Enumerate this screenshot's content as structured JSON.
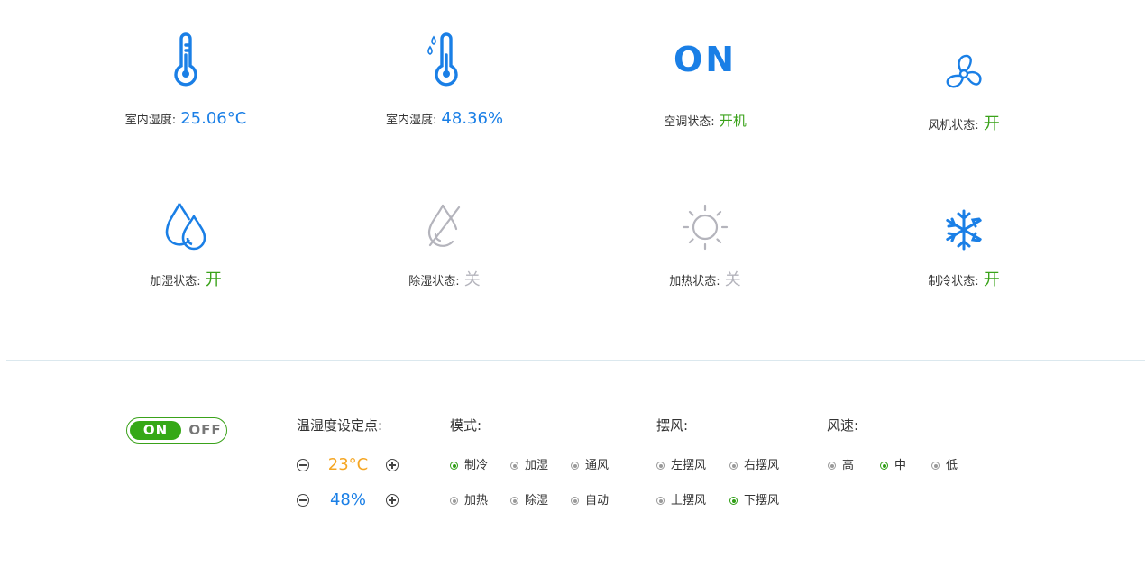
{
  "status": {
    "indoor_temp": {
      "label": "室内湿度:",
      "value": "25.06°C",
      "icon": "thermometer-icon"
    },
    "indoor_humidity": {
      "label": "室内湿度:",
      "value": "48.36%",
      "icon": "humidity-thermometer-icon"
    },
    "ac_state": {
      "icon_text": "ON",
      "label": "空调状态:",
      "value": "开机"
    },
    "fan_state": {
      "label": "风机状态:",
      "value": "开",
      "icon": "fan-icon"
    },
    "humidify_state": {
      "label": "加湿状态:",
      "value": "开",
      "icon": "water-drops-icon"
    },
    "dehumidify_state": {
      "label": "除湿状态:",
      "value": "关",
      "icon": "no-water-drop-icon"
    },
    "heating_state": {
      "label": "加热状态:",
      "value": "关",
      "icon": "sun-icon"
    },
    "cooling_state": {
      "label": "制冷状态:",
      "value": "开",
      "icon": "snowflake-icon"
    }
  },
  "colors": {
    "blue": "#1a7fe6",
    "green": "#3aa21a",
    "gray": "#b4b4bc",
    "orange": "#f5a623"
  },
  "power_toggle": {
    "on_label": "ON",
    "off_label": "OFF",
    "state": "on"
  },
  "setpoint": {
    "title": "温湿度设定点:",
    "temperature": "23°C",
    "humidity": "48%"
  },
  "mode": {
    "title": "模式:",
    "options": [
      "制冷",
      "加湿",
      "通风",
      "加热",
      "除湿",
      "自动"
    ],
    "selected": "制冷"
  },
  "swing": {
    "title": "摆风:",
    "options": [
      "左摆风",
      "右摆风",
      "上摆风",
      "下摆风"
    ],
    "selected": "下摆风"
  },
  "fan_speed": {
    "title": "风速:",
    "options": [
      "高",
      "中",
      "低"
    ],
    "selected": "中"
  }
}
